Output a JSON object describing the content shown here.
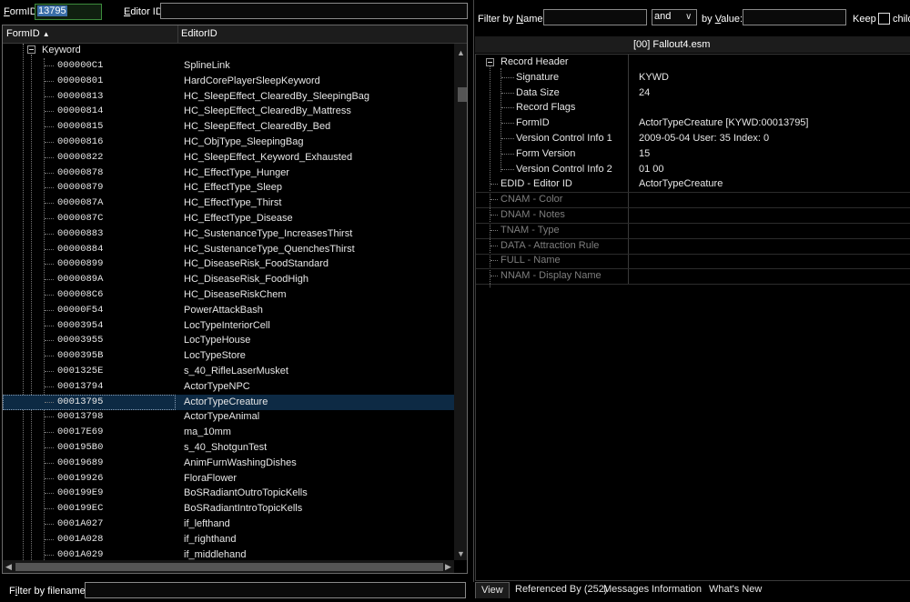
{
  "top_left": {
    "formid_label": "FormID",
    "formid_value": "13795",
    "editorid_label": "Editor ID",
    "editorid_value": ""
  },
  "left_table": {
    "columns": [
      "FormID",
      "EditorID"
    ],
    "group_label": "Keyword",
    "rows": [
      {
        "formid": "000000C1",
        "editorid": "SplineLink"
      },
      {
        "formid": "00000801",
        "editorid": "HardCorePlayerSleepKeyword"
      },
      {
        "formid": "00000813",
        "editorid": "HC_SleepEffect_ClearedBy_SleepingBag"
      },
      {
        "formid": "00000814",
        "editorid": "HC_SleepEffect_ClearedBy_Mattress"
      },
      {
        "formid": "00000815",
        "editorid": "HC_SleepEffect_ClearedBy_Bed"
      },
      {
        "formid": "00000816",
        "editorid": "HC_ObjType_SleepingBag"
      },
      {
        "formid": "00000822",
        "editorid": "HC_SleepEffect_Keyword_Exhausted"
      },
      {
        "formid": "00000878",
        "editorid": "HC_EffectType_Hunger"
      },
      {
        "formid": "00000879",
        "editorid": "HC_EffectType_Sleep"
      },
      {
        "formid": "0000087A",
        "editorid": "HC_EffectType_Thirst"
      },
      {
        "formid": "0000087C",
        "editorid": "HC_EffectType_Disease"
      },
      {
        "formid": "00000883",
        "editorid": "HC_SustenanceType_IncreasesThirst"
      },
      {
        "formid": "00000884",
        "editorid": "HC_SustenanceType_QuenchesThirst"
      },
      {
        "formid": "00000899",
        "editorid": "HC_DiseaseRisk_FoodStandard"
      },
      {
        "formid": "0000089A",
        "editorid": "HC_DiseaseRisk_FoodHigh"
      },
      {
        "formid": "000008C6",
        "editorid": "HC_DiseaseRiskChem"
      },
      {
        "formid": "00000F54",
        "editorid": "PowerAttackBash"
      },
      {
        "formid": "00003954",
        "editorid": "LocTypeInteriorCell"
      },
      {
        "formid": "00003955",
        "editorid": "LocTypeHouse"
      },
      {
        "formid": "0000395B",
        "editorid": "LocTypeStore"
      },
      {
        "formid": "0001325E",
        "editorid": "s_40_RifleLaserMusket"
      },
      {
        "formid": "00013794",
        "editorid": "ActorTypeNPC"
      },
      {
        "formid": "00013795",
        "editorid": "ActorTypeCreature"
      },
      {
        "formid": "00013798",
        "editorid": "ActorTypeAnimal"
      },
      {
        "formid": "00017E69",
        "editorid": "ma_10mm"
      },
      {
        "formid": "000195B0",
        "editorid": "s_40_ShotgunTest"
      },
      {
        "formid": "00019689",
        "editorid": "AnimFurnWashingDishes"
      },
      {
        "formid": "00019926",
        "editorid": "FloraFlower"
      },
      {
        "formid": "000199E9",
        "editorid": "BoSRadiantOutroTopicKells"
      },
      {
        "formid": "000199EC",
        "editorid": "BoSRadiantIntroTopicKells"
      },
      {
        "formid": "0001A027",
        "editorid": "if_lefthand"
      },
      {
        "formid": "0001A028",
        "editorid": "if_righthand"
      },
      {
        "formid": "0001A029",
        "editorid": "if_middlehand"
      }
    ],
    "selected_formid": "00013795"
  },
  "bottom_left": {
    "filter_label": "Filter by filename:",
    "filter_value": ""
  },
  "right_top": {
    "filter_name_label": "Filter by Name:",
    "filter_name_value": "",
    "combo_value": "and",
    "by_value_label": "by Value:",
    "by_value_value": "",
    "keep_label": "Keep",
    "child_label": "child"
  },
  "right_table": {
    "file_header": "[00] Fallout4.esm",
    "rows": [
      {
        "key": "Record Header",
        "value": "",
        "indent": 1,
        "expander": true,
        "dim": false
      },
      {
        "key": "Signature",
        "value": "KYWD",
        "indent": 2,
        "dim": false
      },
      {
        "key": "Data Size",
        "value": "24",
        "indent": 2,
        "dim": false
      },
      {
        "key": "Record Flags",
        "value": "",
        "indent": 2,
        "dim": false
      },
      {
        "key": "FormID",
        "value": "ActorTypeCreature [KYWD:00013795]",
        "indent": 2,
        "dim": false
      },
      {
        "key": "Version Control Info 1",
        "value": "2009-05-04 User: 35 Index: 0",
        "indent": 2,
        "dim": false
      },
      {
        "key": "Form Version",
        "value": "15",
        "indent": 2,
        "dim": false
      },
      {
        "key": "Version Control Info 2",
        "value": "01 00",
        "indent": 2,
        "dim": false
      },
      {
        "key": "EDID - Editor ID",
        "value": "ActorTypeCreature",
        "indent": 1,
        "dim": false
      },
      {
        "key": "CNAM - Color",
        "value": "",
        "indent": 1,
        "dim": true
      },
      {
        "key": "DNAM - Notes",
        "value": "",
        "indent": 1,
        "dim": true
      },
      {
        "key": "TNAM - Type",
        "value": "",
        "indent": 1,
        "dim": true
      },
      {
        "key": "DATA - Attraction Rule",
        "value": "",
        "indent": 1,
        "dim": true
      },
      {
        "key": "FULL - Name",
        "value": "",
        "indent": 1,
        "dim": true
      },
      {
        "key": "NNAM - Display Name",
        "value": "",
        "indent": 1,
        "dim": true
      }
    ]
  },
  "tabs": [
    "View",
    "Referenced By (252)",
    "Messages",
    "Information",
    "What's New"
  ],
  "active_tab": "View"
}
